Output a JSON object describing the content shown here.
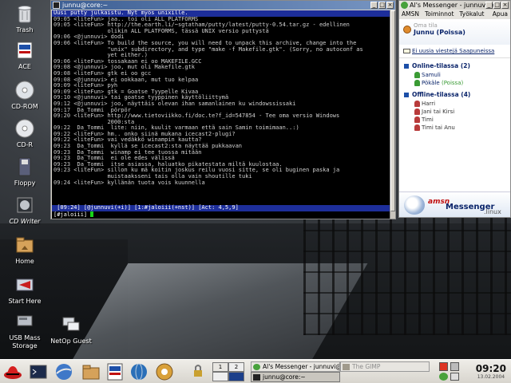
{
  "desktop": {
    "icons": [
      {
        "label": "Trash"
      },
      {
        "label": "ACE"
      },
      {
        "label": "CD-ROM"
      },
      {
        "label": "CD-R"
      },
      {
        "label": "Floppy"
      },
      {
        "label": "CD Writer"
      },
      {
        "label": "Home"
      },
      {
        "label": "Start Here"
      },
      {
        "label": "USB Mass\nStorage"
      },
      {
        "label": "NetOp Guest"
      }
    ]
  },
  "terminal": {
    "title": "junnu@core:~",
    "topic": "Uusi putty julkaistu. Nyt myös unixille.",
    "lines": [
      {
        "time": "09:05",
        "text": "<liteFun> jaa.. toi oli ALL PLATFORMS"
      },
      {
        "time": "09:05",
        "text": "<liteFun> http://the.earth.li/~sgtatham/putty/latest/putty-0.54.tar.gz - edellinen"
      },
      {
        "time": "",
        "text": "          olikin ALL PLATFORMS, tässä UNIX versio puttystä"
      },
      {
        "time": "09:06",
        "text": "<@junnuvi> dodi"
      },
      {
        "time": "09:06",
        "text": "<liteFun> To build the source, you will need to unpack this archive, change into the"
      },
      {
        "time": "",
        "text": "          \"unix\" subdirectory, and type \"make -f Makefile.gtk\". (Sorry, no autoconf as"
      },
      {
        "time": "",
        "text": "          yet either.)"
      },
      {
        "time": "09:06",
        "text": "<liteFun> tossakaan ei oo MAKEFILE.GCC"
      },
      {
        "time": "09:08",
        "text": "<@junnuvi> joo, mut oli Makefile.gtk"
      },
      {
        "time": "09:08",
        "text": "<liteFun> gtk ei oo gcc"
      },
      {
        "time": "09:08",
        "text": "<@junnuvi> ei ookkaan, mut tuo kelpaa"
      },
      {
        "time": "09:09",
        "text": "<liteFun> pyh"
      },
      {
        "time": "09:09",
        "text": "<liteFun> gtk = Goatse Tyypelle Kivaa"
      },
      {
        "time": "09:10",
        "text": "<@junnuvi> tai goatse tyyppinen käyttöliittymä"
      },
      {
        "time": "09:12",
        "text": "<@junnuvi> joo, näyttäis olevan ihan samanlainen ku windowssissaki"
      },
      {
        "time": "09:17",
        "text": " Da_Tommi  pörpör"
      },
      {
        "time": "09:20",
        "text": "<liteFun> http://www.tietoviikko.fi/doc.te?f_id=547854 - Tee oma versio Windows"
      },
      {
        "time": "",
        "text": "          2000:sta"
      },
      {
        "time": "09:22",
        "text": " Da_Tommi  lite: niin, kuulit varmaan että sain Samin toimimaan..:)"
      },
      {
        "time": "09:22",
        "text": "<liteFun> hm.. onko siinä mukana icecast2-plugi?"
      },
      {
        "time": "09:22",
        "text": "<liteFun> vai vedäkkö winampin kautta?"
      },
      {
        "time": "09:23",
        "text": " Da_Tommi  kyllä se icecast2:sta näyttää pukkaavan"
      },
      {
        "time": "09:23",
        "text": " Da_Tommi  winamp ei tee tuossa mitään"
      },
      {
        "time": "09:23",
        "text": " Da_Tommi  ei ole edes välissä"
      },
      {
        "time": "09:23",
        "text": " Da_Tommi  itse asiassa, haluatko pikatestata miltä kuulostaa."
      },
      {
        "time": "09:23",
        "text": "<liteFun> sillon ku mä koitin joskus reilu vuosi sitte, se oli buginen paska ja"
      },
      {
        "time": "",
        "text": "          muistaaksseni tais olla vain shoutille tuki"
      },
      {
        "time": "09:24",
        "text": "<liteFun> kyllänän tuota vois kuunnella"
      }
    ],
    "statusbar": " [09:24] [@junnuvi(+i)] [1:#jaloiii(+nst)] [Act: 4,5,9]",
    "input": "[#jaloiii] "
  },
  "amsn": {
    "title": "Al's Messenger - junnuvi@m",
    "menu": [
      "AMSN",
      "Toiminnot",
      "Työkalut",
      "Apua"
    ],
    "my_label": "Oma tila",
    "my_name": "Junnu (Poissa)",
    "mail": "Ei uusia viestejä Saapuneissa",
    "online_group": "Online-tilassa",
    "online_count": "(2)",
    "online": [
      {
        "name": "Samuli",
        "status": ""
      },
      {
        "name": "Pökäle",
        "status": "(Poissa)"
      }
    ],
    "offline_group": "Offline-tilassa",
    "offline_count": "(4)",
    "offline": [
      {
        "name": "Harri"
      },
      {
        "name": "Jani tai Kirsi"
      },
      {
        "name": "Timi"
      },
      {
        "name": "Timi tai Anu"
      }
    ],
    "logo_amsn": "amsn",
    "logo_messenger": "Messenger",
    "logo_linux": ".linux"
  },
  "taskbar": {
    "pager": [
      "1",
      "2"
    ],
    "tasks": [
      {
        "label": "Al's Messenger - junnuvi@m",
        "state": "normal"
      },
      {
        "label": "The GIMP",
        "state": "dim"
      },
      {
        "label": "junnu@core:~",
        "state": "active"
      }
    ],
    "time": "09:20",
    "date": "13.02.2004"
  },
  "colors": {
    "terminal_bg": "#000000",
    "topic_bar": "#1d2e9a",
    "cursor": "#18d418",
    "title_active": "#3c5e93"
  }
}
